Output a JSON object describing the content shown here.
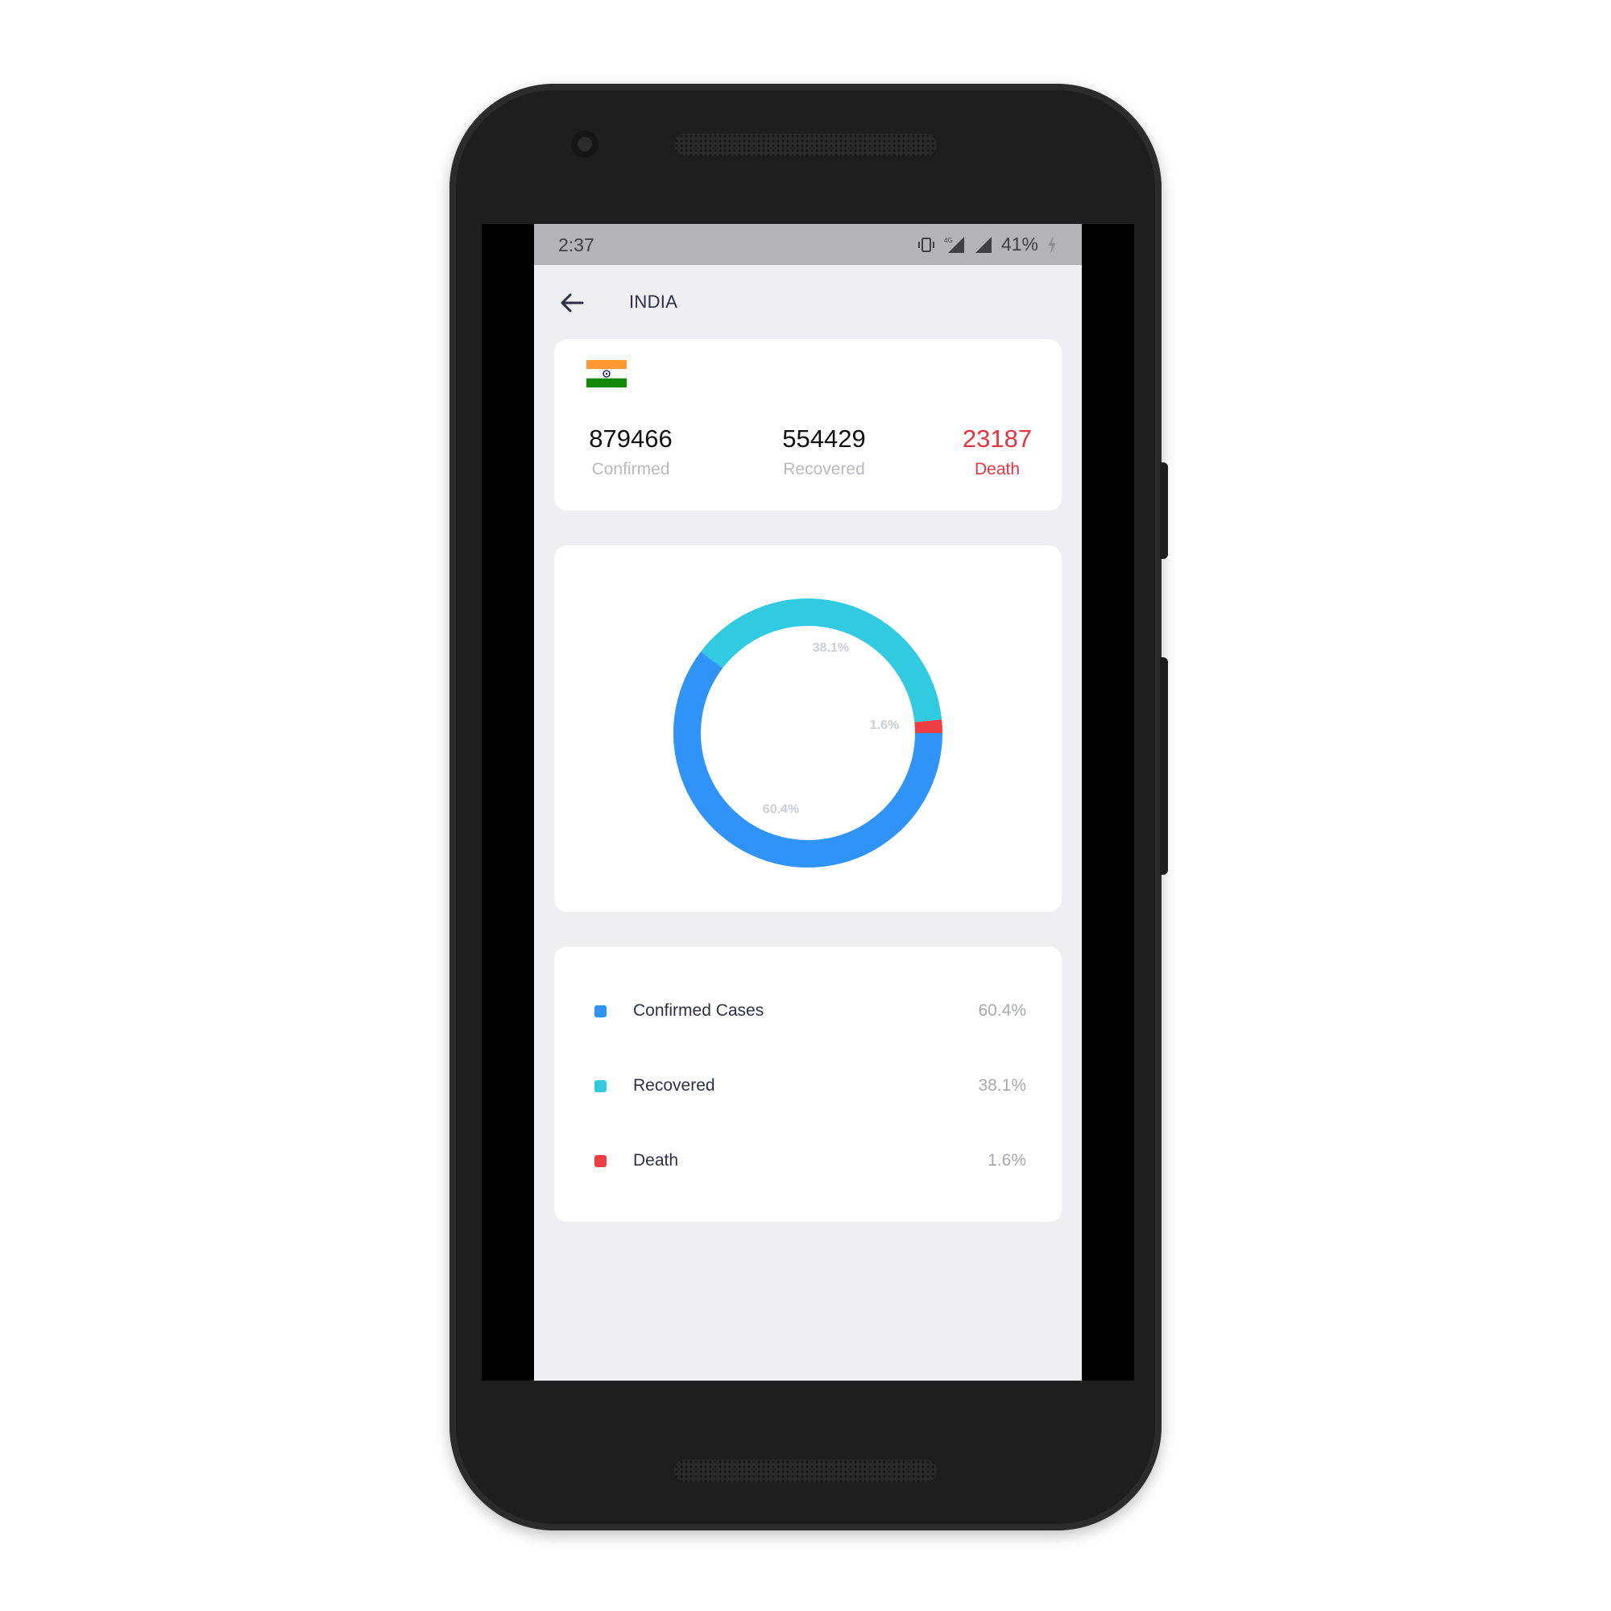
{
  "status_bar": {
    "time": "2:37",
    "battery": "41%"
  },
  "header": {
    "title": "INDIA"
  },
  "summary": {
    "confirmed": {
      "value": "879466",
      "label": "Confirmed"
    },
    "recovered": {
      "value": "554429",
      "label": "Recovered"
    },
    "death": {
      "value": "23187",
      "label": "Death"
    }
  },
  "colors": {
    "confirmed": "#2f93fa",
    "recovered": "#30cbe0",
    "death": "#ee3c43",
    "death_text": "#e7343f"
  },
  "chart_data": {
    "type": "pie",
    "variant": "donut",
    "categories": [
      "Confirmed Cases",
      "Recovered",
      "Death"
    ],
    "values": [
      60.4,
      38.1,
      1.6
    ],
    "labels": [
      "60.4%",
      "38.1%",
      "1.6%"
    ]
  },
  "legend": [
    {
      "label": "Confirmed Cases",
      "value": "60.4%"
    },
    {
      "label": "Recovered",
      "value": "38.1%"
    },
    {
      "label": "Death",
      "value": "1.6%"
    }
  ]
}
